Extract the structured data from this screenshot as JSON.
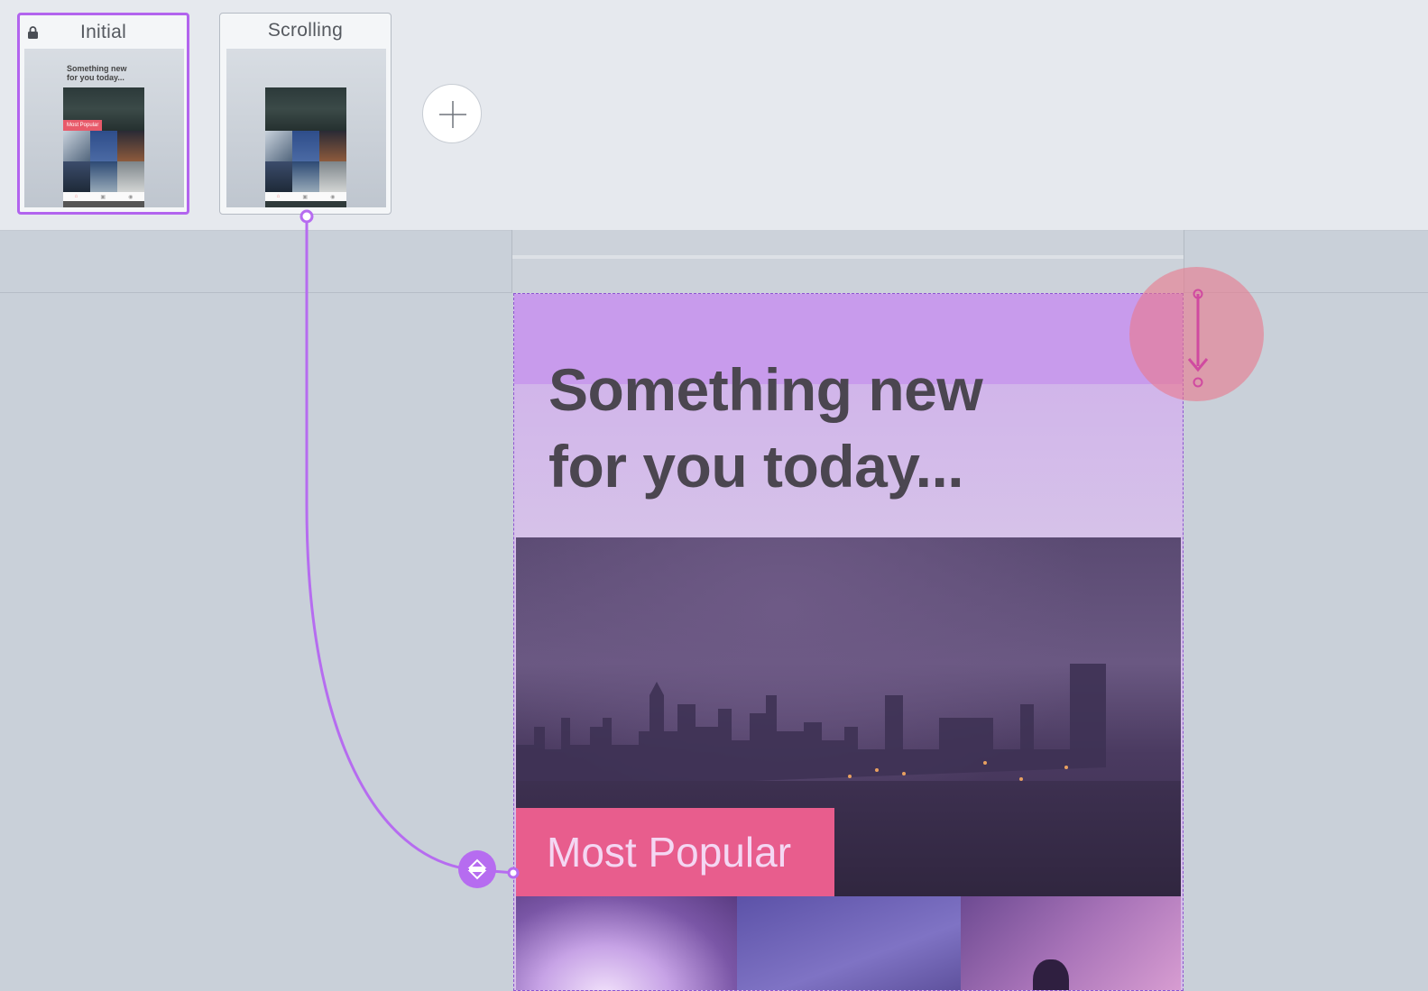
{
  "states": [
    {
      "label": "Initial",
      "locked": true,
      "active": true
    },
    {
      "label": "Scrolling",
      "locked": false,
      "active": false
    }
  ],
  "thumbnail": {
    "headline": "Something new\nfor you today...",
    "badge": "Most Popular"
  },
  "add_state": {
    "icon": "plus-icon"
  },
  "screen": {
    "headline": "Something new for you today...",
    "badge": "Most Popular"
  },
  "colors": {
    "accent": "#b264ee",
    "gesture": "#e9788c",
    "badge": "#e85d8d"
  },
  "icons": {
    "lock": "lock-icon",
    "gesture": "scroll-down-gesture-icon",
    "handle": "expand-collapse-icon"
  }
}
